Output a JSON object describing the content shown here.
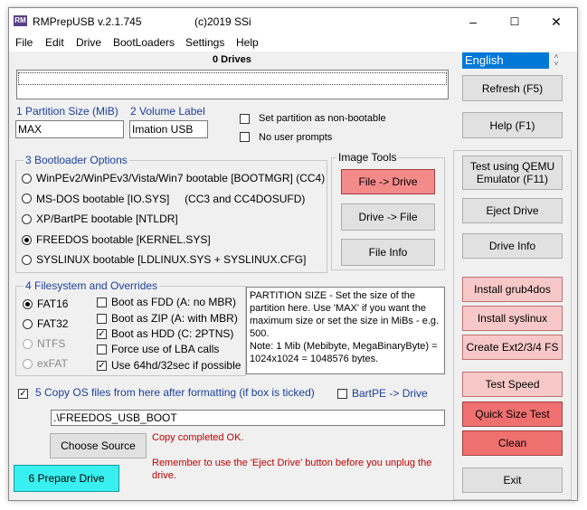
{
  "window": {
    "title": "RMPrepUSB v.2.1.745",
    "copyright": "(c)2019 SSi",
    "icon_label": "RM",
    "minimize": "–",
    "maximize": "☐",
    "close": "✕"
  },
  "menu": [
    "File",
    "Edit",
    "Drive",
    "BootLoaders",
    "Settings",
    "Help"
  ],
  "drives_count": "0 Drives",
  "partition": {
    "size_label": "1 Partition Size (MiB)",
    "size_value": "MAX",
    "volume_label": "2 Volume Label",
    "volume_value": "Imation USB",
    "non_bootable_label": "Set partition as non-bootable",
    "no_user_prompts_label": "No user prompts"
  },
  "bootloader": {
    "group_title": "3 Bootloader Options",
    "options": [
      "WinPEv2/WinPEv3/Vista/Win7 bootable [BOOTMGR] (CC4)",
      "MS-DOS bootable [IO.SYS]     (CC3 and CC4DOSUFD)",
      "XP/BartPE bootable [NTLDR]",
      "FREEDOS bootable [KERNEL.SYS]",
      "SYSLINUX bootable [LDLINUX.SYS + SYSLINUX.CFG]"
    ],
    "selected_index": 3
  },
  "image_tools": {
    "group_title": "Image Tools",
    "file_to_drive": "File -> Drive",
    "drive_to_file": "Drive -> File",
    "file_info": "File Info"
  },
  "filesystem": {
    "group_title": "4 Filesystem and Overrides",
    "fs_options": [
      "FAT16",
      "FAT32",
      "NTFS",
      "exFAT"
    ],
    "selected_fs": "FAT16",
    "overrides": [
      {
        "label": "Boot as FDD (A: no MBR)",
        "checked": false
      },
      {
        "label": "Boot as ZIP (A: with MBR)",
        "checked": false
      },
      {
        "label": "Boot as HDD (C: 2PTNS)",
        "checked": true
      },
      {
        "label": "Force use of LBA calls",
        "checked": false
      },
      {
        "label": "Use 64hd/32sec if possible",
        "checked": true
      }
    ]
  },
  "help_text": "PARTITION SIZE - Set the size of the partition here. Use 'MAX' if you want the maximum size or set the size in MiBs - e.g. 500.\nNote: 1 Mib (Mebibyte, MegaBinaryByte) = 1024x1024 = 1048576 bytes.",
  "copy_os": {
    "label": "5 Copy OS files from here after formatting (if box is ticked)",
    "checked": true,
    "bartpe_label": "BartPE -> Drive",
    "path_value": ".\\FREEDOS_USB_BOOT",
    "choose_source": "Choose Source"
  },
  "status": {
    "line1": "Copy completed OK.",
    "line2": "Remember to use the 'Eject Drive' button before you unplug the drive."
  },
  "prepare_drive": "6 Prepare Drive",
  "right_panel": {
    "language": "English",
    "refresh": "Refresh (F5)",
    "help": "Help (F1)",
    "qemu": "Test using QEMU Emulator (F11)",
    "eject": "Eject Drive",
    "drive_info": "Drive Info",
    "grub4dos": "Install grub4dos",
    "syslinux": "Install syslinux",
    "ext": "Create Ext2/3/4 FS",
    "test_speed": "Test Speed",
    "quick_size": "Quick Size Test",
    "clean": "Clean",
    "exit": "Exit"
  },
  "colors": {
    "pink_button": "#f8c8c8",
    "red_button": "#f07070",
    "cyan_button": "#38f0f0",
    "label_blue": "#1b3f9a",
    "status_red": "#c00000",
    "language_bg": "#0078d7"
  }
}
